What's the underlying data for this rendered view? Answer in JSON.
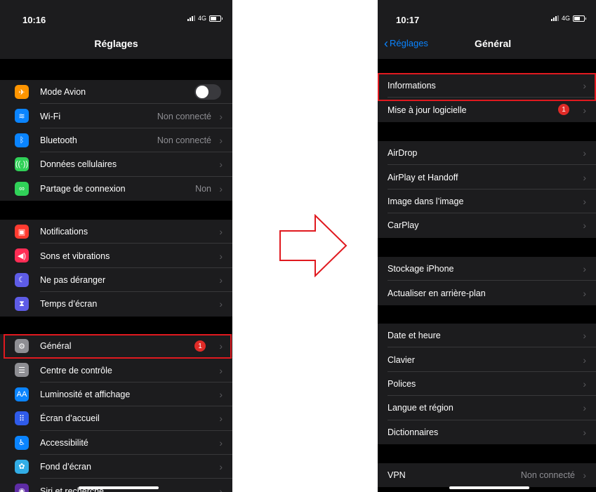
{
  "left": {
    "time": "10:16",
    "network": "4G",
    "title": "Réglages",
    "groups": [
      [
        {
          "label": "Mode Avion",
          "icon": "airplane-icon",
          "color": "#ff9500",
          "glyph": "✈",
          "toggle": true
        },
        {
          "label": "Wi-Fi",
          "icon": "wifi-icon",
          "color": "#0a84ff",
          "glyph": "≋",
          "value": "Non connecté"
        },
        {
          "label": "Bluetooth",
          "icon": "bluetooth-icon",
          "color": "#0a84ff",
          "glyph": "ᛒ",
          "value": "Non connecté"
        },
        {
          "label": "Données cellulaires",
          "icon": "cellular-icon",
          "color": "#30d158",
          "glyph": "((·))"
        },
        {
          "label": "Partage de connexion",
          "icon": "hotspot-icon",
          "color": "#30d158",
          "glyph": "∞",
          "value": "Non"
        }
      ],
      [
        {
          "label": "Notifications",
          "icon": "notifications-icon",
          "color": "#ff3b30",
          "glyph": "▣"
        },
        {
          "label": "Sons et vibrations",
          "icon": "sounds-icon",
          "color": "#ff2d55",
          "glyph": "◀)"
        },
        {
          "label": "Ne pas déranger",
          "icon": "moon-icon",
          "color": "#5e5ce6",
          "glyph": "☾"
        },
        {
          "label": "Temps d’écran",
          "icon": "hourglass-icon",
          "color": "#5e5ce6",
          "glyph": "⧗"
        }
      ],
      [
        {
          "label": "Général",
          "icon": "gear-icon",
          "color": "#8e8e93",
          "glyph": "⚙",
          "badge": "1"
        },
        {
          "label": "Centre de contrôle",
          "icon": "control-center-icon",
          "color": "#8e8e93",
          "glyph": "☰"
        },
        {
          "label": "Luminosité et affichage",
          "icon": "brightness-icon",
          "color": "#0a84ff",
          "glyph": "AA"
        },
        {
          "label": "Écran d’accueil",
          "icon": "home-screen-icon",
          "color": "#2f5bea",
          "glyph": "⠿"
        },
        {
          "label": "Accessibilité",
          "icon": "accessibility-icon",
          "color": "#0a84ff",
          "glyph": "♿"
        },
        {
          "label": "Fond d’écran",
          "icon": "wallpaper-icon",
          "color": "#32ade6",
          "glyph": "✿"
        },
        {
          "label": "Siri et recherche",
          "icon": "siri-icon",
          "color": "#5e2ca5",
          "glyph": "◉"
        }
      ]
    ]
  },
  "right": {
    "time": "10:17",
    "network": "4G",
    "back": "Réglages",
    "title": "Général",
    "groups": [
      [
        {
          "label": "Informations"
        },
        {
          "label": "Mise à jour logicielle",
          "badge": "1"
        }
      ],
      [
        {
          "label": "AirDrop"
        },
        {
          "label": "AirPlay et Handoff"
        },
        {
          "label": "Image dans l’image"
        },
        {
          "label": "CarPlay"
        }
      ],
      [
        {
          "label": "Stockage iPhone"
        },
        {
          "label": "Actualiser en arrière-plan"
        }
      ],
      [
        {
          "label": "Date et heure"
        },
        {
          "label": "Clavier"
        },
        {
          "label": "Polices"
        },
        {
          "label": "Langue et région"
        },
        {
          "label": "Dictionnaires"
        }
      ],
      [
        {
          "label": "VPN",
          "value": "Non connecté"
        }
      ]
    ]
  },
  "colors": {
    "highlight": "#e0191f",
    "badge": "#e02b27",
    "link": "#0a84ff"
  }
}
